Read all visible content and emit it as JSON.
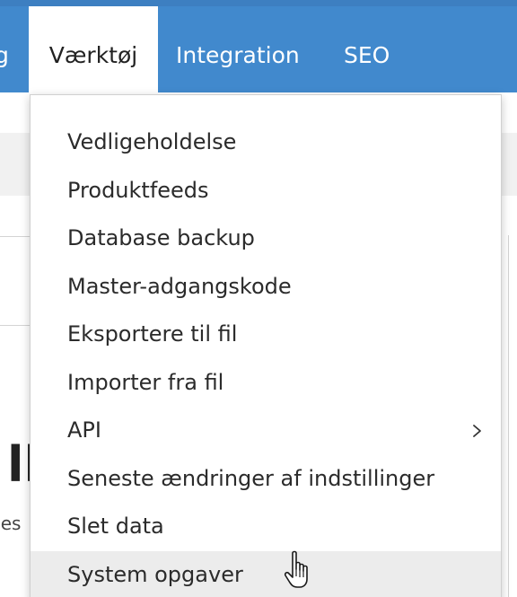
{
  "navbar": {
    "partial_item": "g",
    "active_item": "Værktøj",
    "items": [
      "Integration",
      "SEO"
    ]
  },
  "background": {
    "partial_heading": "ll",
    "partial_text": "pes"
  },
  "dropdown": {
    "items": [
      {
        "label": "Vedligeholdelse"
      },
      {
        "label": "Produktfeeds"
      },
      {
        "label": "Database backup"
      },
      {
        "label": "Master-adgangskode"
      },
      {
        "label": "Eksportere til fil"
      },
      {
        "label": "Importer fra fil"
      },
      {
        "label": "API",
        "submenu_icon": "chevron-right-icon"
      },
      {
        "label": "Seneste ændringer af indstillinger"
      },
      {
        "label": "Slet data"
      },
      {
        "label": "System opgaver",
        "hovered": true
      }
    ]
  },
  "cursor": {
    "icon": "hand-pointer-icon"
  },
  "colors": {
    "navbar": "#4189cd",
    "hover": "#ececec",
    "text": "#2b2b2b"
  }
}
